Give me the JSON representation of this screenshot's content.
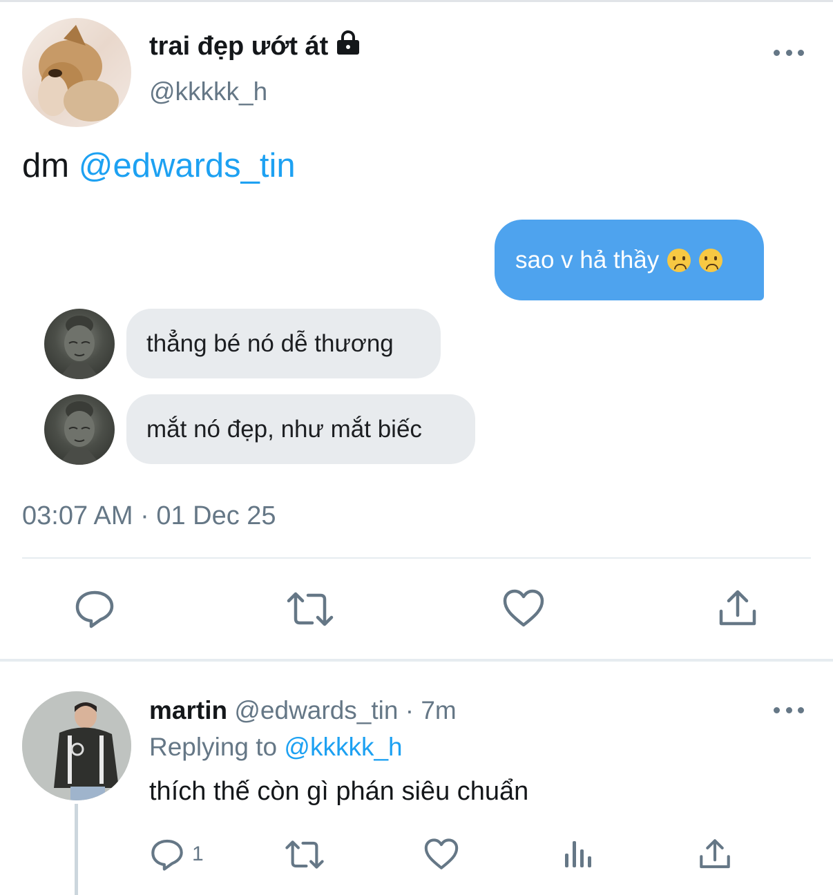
{
  "tweet": {
    "display_name": "trai đẹp ướt át",
    "handle": "@kkkkk_h",
    "text_prefix": "dm",
    "mention": "@edwards_tin",
    "timestamp": "03:07 AM · 01 Dec 25",
    "lock_icon": "lock-icon",
    "more_icon": "more-icon"
  },
  "chat": {
    "sent_message": "sao v hả thầy",
    "sent_emojis": [
      "sad-face-emoji",
      "sad-face-emoji"
    ],
    "received_messages": [
      "thẳng bé nó dễ thương",
      "mắt nó đẹp, như mắt biếc"
    ],
    "sent_bubble_color": "#4ea3ee",
    "received_bubble_color": "#e8ebee"
  },
  "actions": {
    "icons": [
      "reply-icon",
      "retweet-icon",
      "like-icon",
      "share-icon"
    ]
  },
  "reply": {
    "display_name": "martin",
    "handle": "@edwards_tin",
    "separator": "·",
    "time_ago": "7m",
    "replying_label": "Replying to",
    "replying_to": "@kkkkk_h",
    "text": "thích thế còn gì phán siêu chuẩn",
    "reply_count": "1",
    "icons": [
      "reply-icon",
      "retweet-icon",
      "like-icon",
      "analytics-icon",
      "share-icon"
    ]
  },
  "colors": {
    "accent": "#1da1f2",
    "secondary_text": "#657786",
    "primary_text": "#14171a"
  }
}
